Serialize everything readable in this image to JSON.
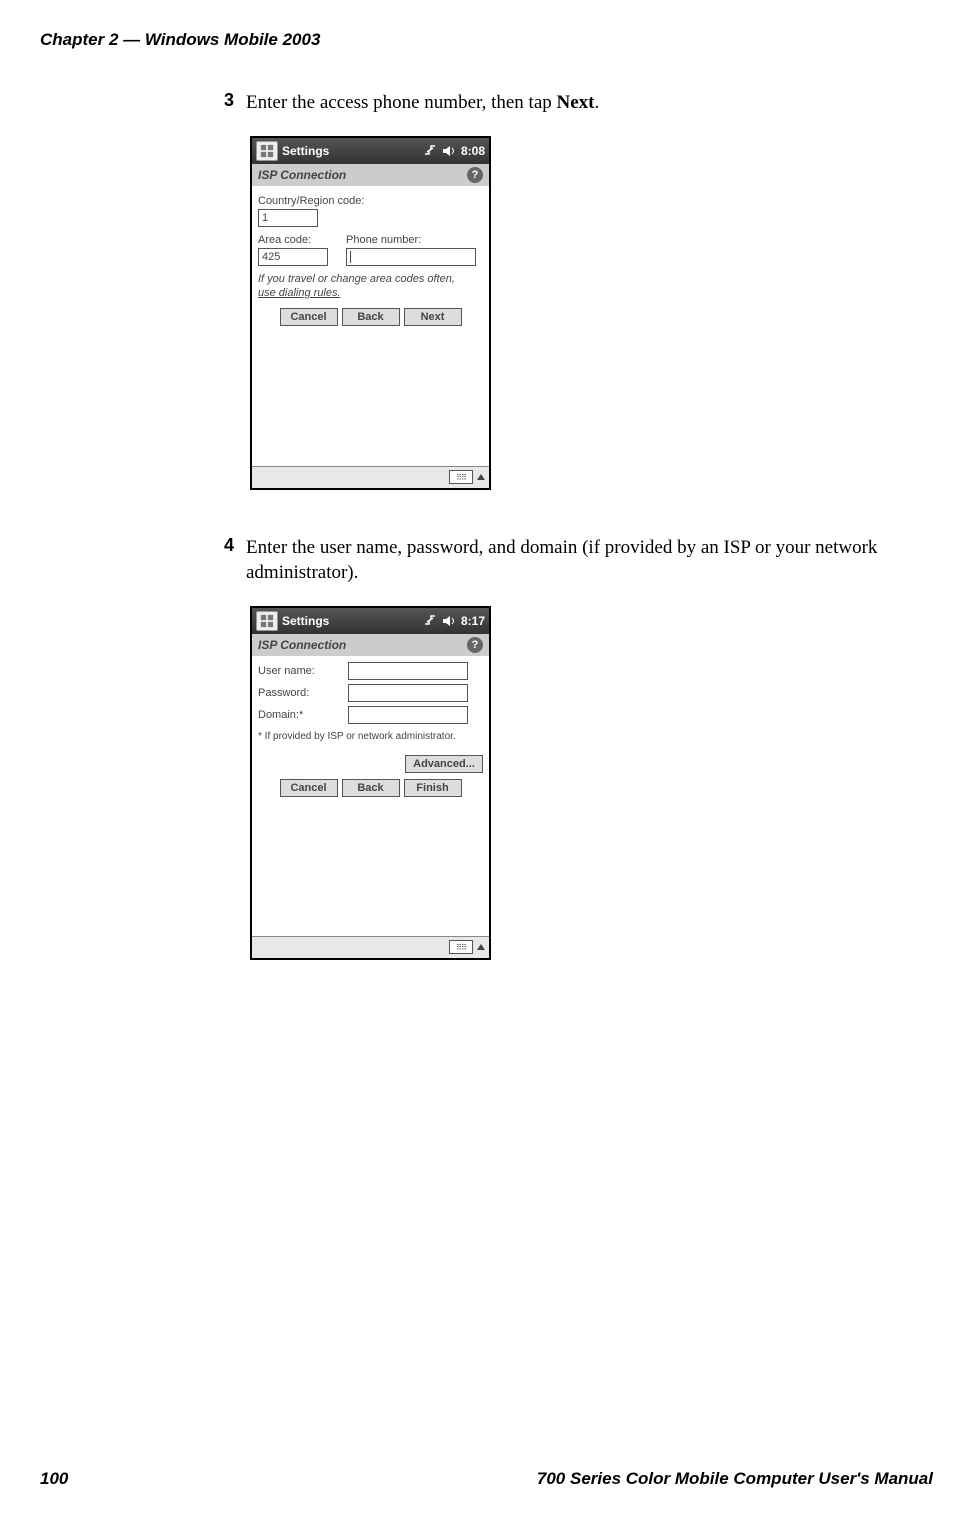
{
  "page": {
    "header": "Chapter 2  —  Windows Mobile 2003",
    "footer_left": "100",
    "footer_right": "700 Series Color Mobile Computer User's Manual"
  },
  "steps": {
    "s3": {
      "num": "3",
      "text_before": "Enter the access phone number, then tap ",
      "text_bold": "Next",
      "text_after": "."
    },
    "s4": {
      "num": "4",
      "text": "Enter the user name, password, and domain (if provided by an ISP or your network administrator)."
    }
  },
  "screenshot1": {
    "titlebar_title": "Settings",
    "time": "8:08",
    "subheader": "ISP Connection",
    "help_icon": "?",
    "labels": {
      "country": "Country/Region code:",
      "area": "Area code:",
      "phone": "Phone number:"
    },
    "values": {
      "country": "1",
      "area": "425",
      "phone": ""
    },
    "hint": {
      "line1": "If you travel or change area codes often,",
      "link": "use dialing rules."
    },
    "buttons": {
      "cancel": "Cancel",
      "back": "Back",
      "next": "Next"
    }
  },
  "screenshot2": {
    "titlebar_title": "Settings",
    "time": "8:17",
    "subheader": "ISP Connection",
    "help_icon": "?",
    "labels": {
      "user": "User name:",
      "password": "Password:",
      "domain": "Domain:*"
    },
    "hint": "* If provided by ISP or network administrator.",
    "buttons": {
      "advanced": "Advanced...",
      "cancel": "Cancel",
      "back": "Back",
      "finish": "Finish"
    }
  }
}
